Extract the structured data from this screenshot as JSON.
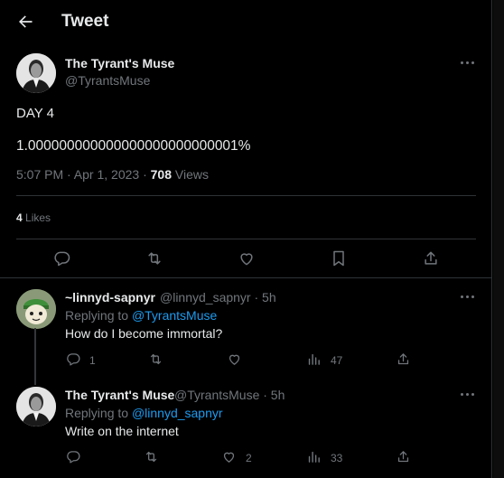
{
  "header": {
    "title": "Tweet"
  },
  "tweet": {
    "display_name": "The Tyrant's Muse",
    "handle": "@TyrantsMuse",
    "lines": [
      "DAY 4",
      "1.000000000000000000000000001%"
    ],
    "time": "5:07 PM · Apr 1, 2023 · ",
    "views_count": "708",
    "views_label": " Views",
    "likes_count": "4",
    "likes_label": " Likes"
  },
  "replies": [
    {
      "display_name": "~linnyd-sapnyr",
      "handle_time": "@linnyd_sapnyr · 5h",
      "replying_prefix": "Replying to ",
      "replying_to": "@TyrantsMuse",
      "text": "How do I become immortal?",
      "reply_count": "1",
      "retweet_count": "",
      "like_count": "",
      "views_count": "47",
      "avatar_icon": "cartoon-character-avatar"
    },
    {
      "display_name": "The Tyrant's Muse",
      "handle_time": "@TyrantsMuse · 5h",
      "replying_prefix": "Replying to ",
      "replying_to": "@linnyd_sapnyr",
      "text": "Write on the internet",
      "reply_count": "",
      "retweet_count": "",
      "like_count": "2",
      "views_count": "33",
      "avatar_icon": "man-in-suit-avatar"
    }
  ],
  "colors": {
    "background": "#000000",
    "text": "#e7e9ea",
    "muted": "#71767b",
    "link": "#1d9bf0",
    "border": "#2f3336"
  }
}
